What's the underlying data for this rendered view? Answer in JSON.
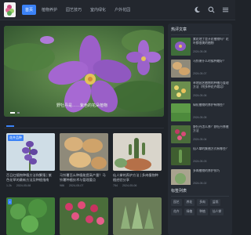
{
  "nav": {
    "items": [
      "首页",
      "植物养护",
      "园艺技巧",
      "室内绿化",
      "户外花园"
    ],
    "active_index": 0
  },
  "hero": {
    "caption": "野牡丹是……紫色的花朵植物"
  },
  "cards": [
    {
      "tag": "花卉品种",
      "title": "百日红植物种植方法和繁殖 | 紫色花草的最新方法及种植指南",
      "views": "1.2k",
      "date": "2024-05-08"
    },
    {
      "tag": "",
      "title": "马铃薯怎么种植能提高产量？马铃薯种植技术与管理要点",
      "views": "986",
      "date": "2024-05-07"
    },
    {
      "tag": "",
      "title": "仙人掌的养护方法 | 多肉植物种植经验分享",
      "views": "754",
      "date": "2024-05-06"
    }
  ],
  "side": {
    "heading": "热评文章",
    "items": [
      {
        "title": "紫花地丁是开花植物吗？花叶都很美的植物",
        "date": "2024-05-08"
      },
      {
        "title": "马铃薯什么时候种最好？",
        "date": "2024-05-07"
      },
      {
        "title": "草地园艺植物的种植与管理方法（附多种花卉栽培）",
        "date": "2024-05-06"
      },
      {
        "title": "绿化植物的养护有哪些？",
        "date": "2024-05-05"
      },
      {
        "title": "野牡丹怎么养？野牡丹养殖方法",
        "date": "2024-05-04"
      },
      {
        "title": "仙人掌的繁殖方式有哪些？",
        "date": "2024-05-03"
      },
      {
        "title": "多肉植物的养护技巧",
        "date": "2024-05-02"
      }
    ]
  },
  "tagblock": {
    "heading": "标签列表",
    "tags": [
      "园艺",
      "养花",
      "多肉",
      "盆栽",
      "花卉",
      "绿植",
      "种植",
      "仙人掌"
    ]
  }
}
